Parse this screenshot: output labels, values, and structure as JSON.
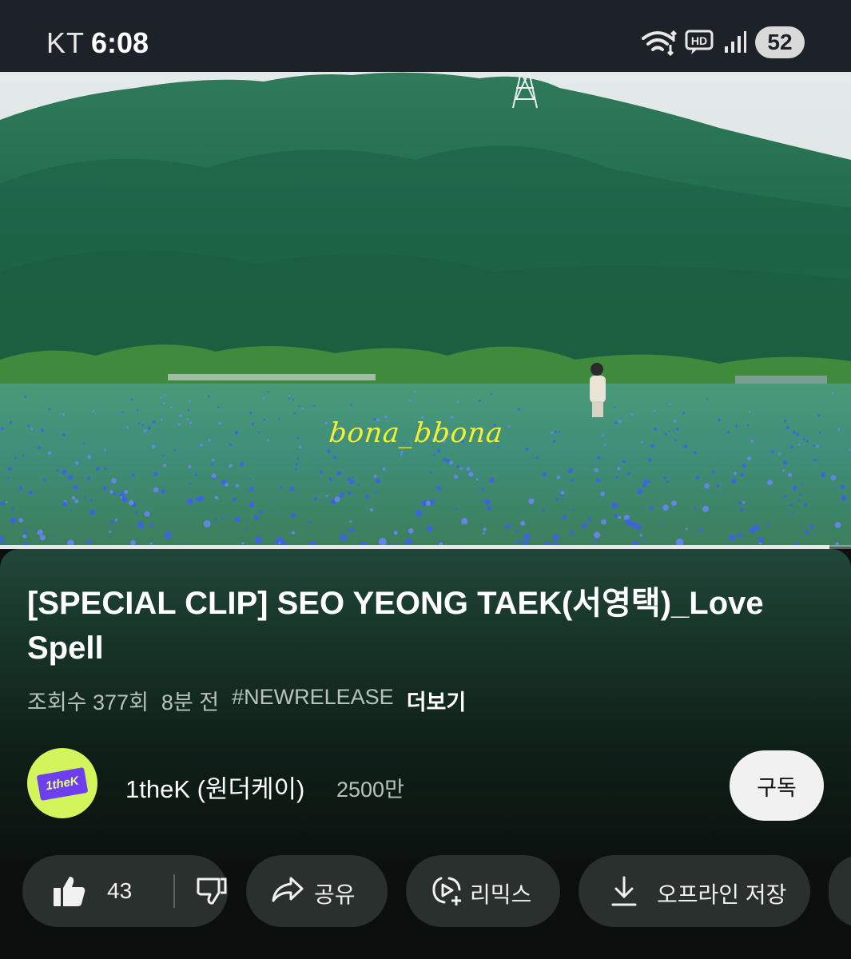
{
  "status_bar": {
    "carrier": "KT",
    "time": "6:08",
    "network_badge": "HD",
    "battery": "52",
    "icons": [
      "wifi-icon",
      "hd-voice-icon",
      "signal-icon",
      "battery-icon"
    ]
  },
  "video": {
    "watermark": "bona_bbona",
    "progress": 0.975
  },
  "info": {
    "title": "[SPECIAL CLIP] SEO YEONG TAEK(서영택)_Love Spell",
    "views": "조회수 377회",
    "uploaded": "8분 전",
    "hashtag": "#NEWRELEASE",
    "more_label": "더보기"
  },
  "channel": {
    "name": "1theK (원더케이)",
    "subscribers": "2500만",
    "avatar_text": "1theK",
    "subscribe_label": "구독"
  },
  "actions": {
    "like_count": "43",
    "share_label": "공유",
    "remix_label": "리믹스",
    "offline_label": "오프라인 저장"
  },
  "colors": {
    "accent_avatar": "#d2f55b",
    "avatar_badge": "#6e3ff0",
    "watermark": "#f6f031",
    "pill_bg": "#2a302d"
  }
}
